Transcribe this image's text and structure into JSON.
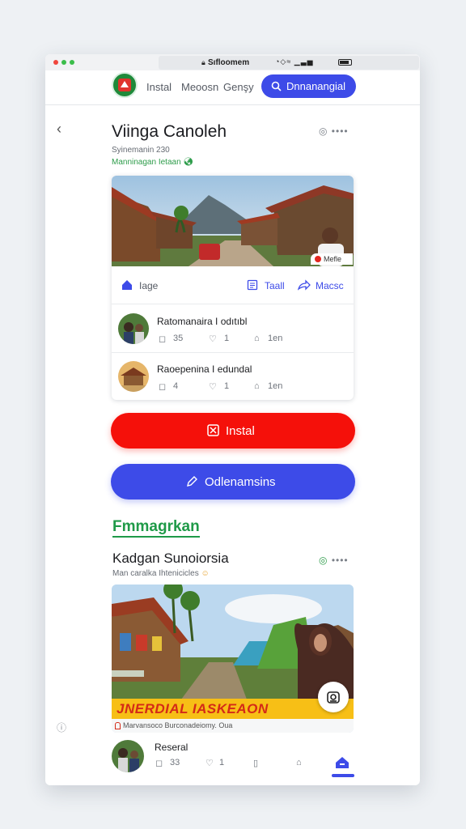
{
  "status_bar": {
    "url": "Sıfloomem"
  },
  "nav": {
    "links": [
      "Instal",
      "Meoosn",
      "Genşy"
    ],
    "search_button": "Dnnanangial"
  },
  "post1": {
    "title": "Viinga Canoleh",
    "subtitle": "Syinemanin 230",
    "tag": "Manninagan Ietaan",
    "live_label": "Mefle",
    "tabs": [
      "Iage",
      "Taall",
      "Macsc"
    ],
    "comments": [
      {
        "title": "Ratomanaira I odıtıbl",
        "replies": "35",
        "likes": "1",
        "shares": "1en"
      },
      {
        "title": "Raoepenina I edundal",
        "replies": "4",
        "likes": "1",
        "shares": "1en"
      }
    ]
  },
  "buttons": {
    "primary": "Instal",
    "secondary": "Odlenamsins"
  },
  "section_title": "Fmmagrkan",
  "post2": {
    "title": "Kadgan Sunoiorsia",
    "subtitle": "Man caralka Ihtenicicles",
    "banner": "JNERDIAL IASKEAON",
    "caption": "Marvansoco Burconadeiomy. Oua",
    "author": "Reseral",
    "replies": "33",
    "likes": "1"
  },
  "colors": {
    "accent": "#3d4be8",
    "primary_button": "#f5100a",
    "green": "#1f9a48"
  }
}
